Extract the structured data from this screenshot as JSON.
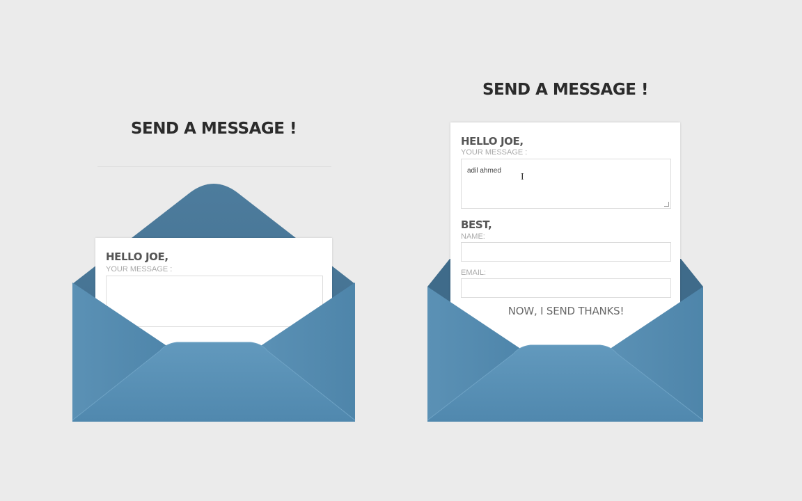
{
  "colors": {
    "background": "#ebebeb",
    "envelope_back": "#4f7fa0",
    "envelope_front": "#5b93b8",
    "envelope_flap": "#4a7a9c",
    "letter": "#ffffff",
    "label": "#a9a9a9",
    "title": "#2b2b2b"
  },
  "left_card": {
    "title": "SEND A MESSAGE !",
    "greeting": "HELLO JOE,",
    "message_label": "YOUR MESSAGE :",
    "message_value": ""
  },
  "right_card": {
    "title": "SEND A MESSAGE !",
    "greeting": "HELLO JOE,",
    "message_label": "YOUR MESSAGE :",
    "message_value": "adil ahmed",
    "sign_off": "BEST,",
    "name_label": "NAME:",
    "name_value": "",
    "email_label": "EMAIL:",
    "email_value": "",
    "send_label": "NOW, I SEND THANKS!"
  },
  "icons": {
    "envelope": "envelope-icon",
    "cursor": "text-cursor-icon"
  }
}
